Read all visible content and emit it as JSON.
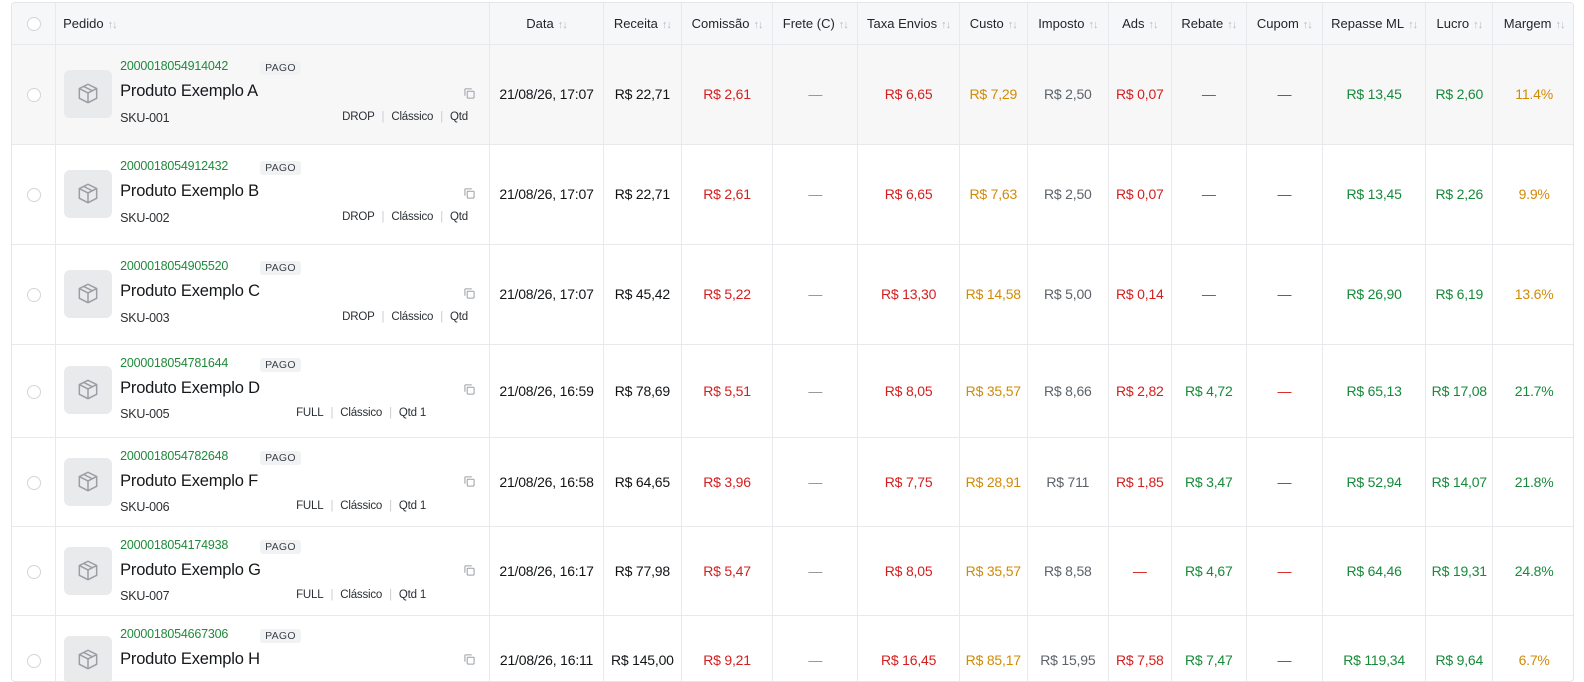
{
  "columns": {
    "pedido": "Pedido",
    "data": "Data",
    "receita": "Receita",
    "comissao": "Comissão",
    "frete": "Frete (C)",
    "taxa": "Taxa Envios",
    "custo": "Custo",
    "imposto": "Imposto",
    "ads": "Ads",
    "rebate": "Rebate",
    "cupom": "Cupom",
    "repasse": "Repasse ML",
    "lucro": "Lucro",
    "margem": "Margem"
  },
  "colors": {
    "order_id": "#1f8a3b",
    "cost_red": "#d3201f",
    "custo_orange": "#d18a06",
    "imposto_gray": "#5d636b",
    "positive_green": "#178a3a"
  },
  "rows": [
    {
      "order_id": "2000018054914042",
      "status": "PAGO",
      "name": "Produto Exemplo A",
      "sku": "SKU-001",
      "tags": [
        "DROP",
        "Clássico",
        "Qtd"
      ],
      "date": "21/08/26, 17:07",
      "receita": "R$ 22,71",
      "comissao": "R$ 2,61",
      "frete": "—",
      "taxa": "R$ 6,65",
      "custo": "R$ 7,29",
      "imposto": "R$ 2,50",
      "ads": "R$ 0,07",
      "rebate": "—",
      "cupom": "—",
      "repasse": "R$ 13,45",
      "lucro": "R$ 2,60",
      "margem": "11.4%"
    },
    {
      "order_id": "2000018054912432",
      "status": "PAGO",
      "name": "Produto Exemplo B",
      "sku": "SKU-002",
      "tags": [
        "DROP",
        "Clássico",
        "Qtd"
      ],
      "date": "21/08/26, 17:07",
      "receita": "R$ 22,71",
      "comissao": "R$ 2,61",
      "frete": "—",
      "taxa": "R$ 6,65",
      "custo": "R$ 7,63",
      "imposto": "R$ 2,50",
      "ads": "R$ 0,07",
      "rebate": "—",
      "cupom": "—",
      "repasse": "R$ 13,45",
      "lucro": "R$ 2,26",
      "margem": "9.9%"
    },
    {
      "order_id": "2000018054905520",
      "status": "PAGO",
      "name": "Produto Exemplo C",
      "sku": "SKU-003",
      "tags": [
        "DROP",
        "Clássico",
        "Qtd"
      ],
      "date": "21/08/26, 17:07",
      "receita": "R$ 45,42",
      "comissao": "R$ 5,22",
      "frete": "—",
      "taxa": "R$ 13,30",
      "custo": "R$ 14,58",
      "imposto": "R$ 5,00",
      "ads": "R$ 0,14",
      "rebate": "—",
      "cupom": "—",
      "repasse": "R$ 26,90",
      "lucro": "R$ 6,19",
      "margem": "13.6%"
    },
    {
      "order_id": "2000018054781644",
      "status": "PAGO",
      "name": "Produto Exemplo D",
      "sku": "SKU-005",
      "tags": [
        "FULL",
        "Clássico",
        "Qtd 1"
      ],
      "date": "21/08/26, 16:59",
      "receita": "R$ 78,69",
      "comissao": "R$ 5,51",
      "frete": "—",
      "taxa": "R$ 8,05",
      "custo": "R$ 35,57",
      "imposto": "R$ 8,66",
      "ads": "R$ 2,82",
      "rebate": "R$ 4,72",
      "cupom": "—",
      "repasse": "R$ 65,13",
      "lucro": "R$ 17,08",
      "margem": "21.7%"
    },
    {
      "order_id": "2000018054782648",
      "status": "PAGO",
      "name": "Produto Exemplo F",
      "sku": "SKU-006",
      "tags": [
        "FULL",
        "Clássico",
        "Qtd 1"
      ],
      "date": "21/08/26, 16:58",
      "receita": "R$ 64,65",
      "comissao": "R$ 3,96",
      "frete": "—",
      "taxa": "R$ 7,75",
      "custo": "R$ 28,91",
      "imposto": "R$ 711",
      "ads": "R$ 1,85",
      "rebate": "R$ 3,47",
      "cupom": "—",
      "repasse": "R$ 52,94",
      "lucro": "R$ 14,07",
      "margem": "21.8%"
    },
    {
      "order_id": "2000018054174938",
      "status": "PAGO",
      "name": "Produto Exemplo G",
      "sku": "SKU-007",
      "tags": [
        "FULL",
        "Clássico",
        "Qtd 1"
      ],
      "date": "21/08/26, 16:17",
      "receita": "R$ 77,98",
      "comissao": "R$ 5,47",
      "frete": "—",
      "taxa": "R$ 8,05",
      "custo": "R$ 35,57",
      "imposto": "R$ 8,58",
      "ads": "—",
      "rebate": "R$ 4,67",
      "cupom": "—",
      "repasse": "R$ 64,46",
      "lucro": "R$ 19,31",
      "margem": "24.8%"
    },
    {
      "order_id": "2000018054667306",
      "status": "PAGO",
      "name": "Produto Exemplo H",
      "sku": "",
      "tags": [],
      "date": "21/08/26, 16:11",
      "receita": "R$ 145,00",
      "comissao": "R$ 9,21",
      "frete": "—",
      "taxa": "R$ 16,45",
      "custo": "R$ 85,17",
      "imposto": "R$ 15,95",
      "ads": "R$ 7,58",
      "rebate": "R$ 7,47",
      "cupom": "—",
      "repasse": "R$ 119,34",
      "lucro": "R$ 9,64",
      "margem": "6.7%"
    }
  ]
}
